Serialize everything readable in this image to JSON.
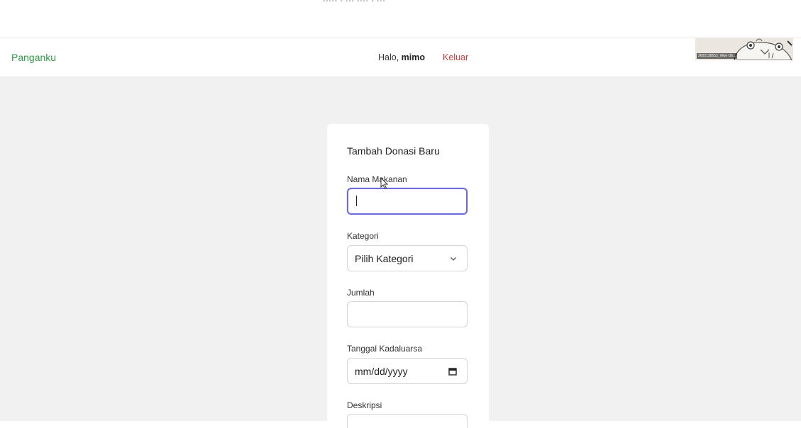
{
  "navbar": {
    "brand": "Panganku",
    "greeting_prefix": "Halo, ",
    "username": "mimo",
    "logout_label": "Keluar"
  },
  "video_thumb": {
    "caption": "2602138553_Wiwi Ob..."
  },
  "form": {
    "title": "Tambah Donasi Baru",
    "fields": {
      "food_name": {
        "label": "Nama Makanan",
        "value": ""
      },
      "category": {
        "label": "Kategori",
        "selected": "Pilih Kategori"
      },
      "quantity": {
        "label": "Jumlah",
        "value": ""
      },
      "expiry_date": {
        "label": "Tanggal Kadaluarsa",
        "placeholder": "mm/dd/yyyy"
      },
      "description": {
        "label": "Deskripsi"
      }
    }
  },
  "colors": {
    "brand": "#2e9b47",
    "logout": "#d13a3a",
    "focus_border": "#6c6ce0",
    "page_background": "#f1f1f1"
  },
  "icons": {
    "category_dropdown": "chevron-down-icon",
    "date_picker": "calendar-icon"
  }
}
